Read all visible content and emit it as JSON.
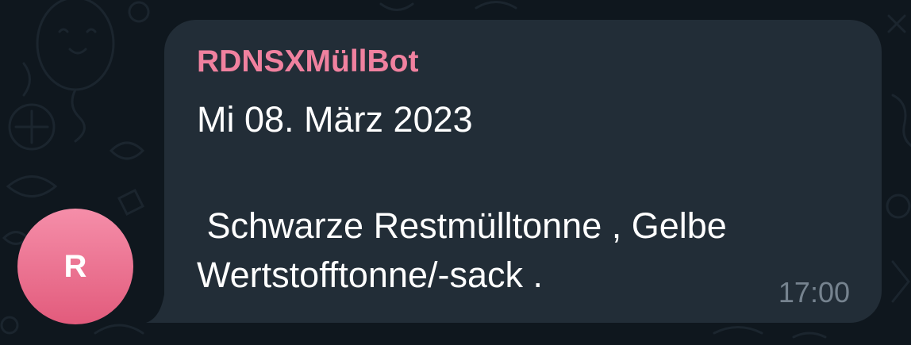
{
  "chat": {
    "avatar_letter": "R",
    "sender": "RDNSXMüllBot",
    "date_line": "Mi 08. März 2023",
    "body_line1": " Schwarze Restmülltonne , Gelbe",
    "body_line2": "Wertstofftonne/-sack .",
    "time": "17:00"
  },
  "colors": {
    "background": "#0f171e",
    "bubble": "#222d37",
    "sender": "#f0819f",
    "avatar": "#ea6e8e",
    "time": "#76838f"
  },
  "icons": [
    "chat-wallpaper-doodles"
  ]
}
